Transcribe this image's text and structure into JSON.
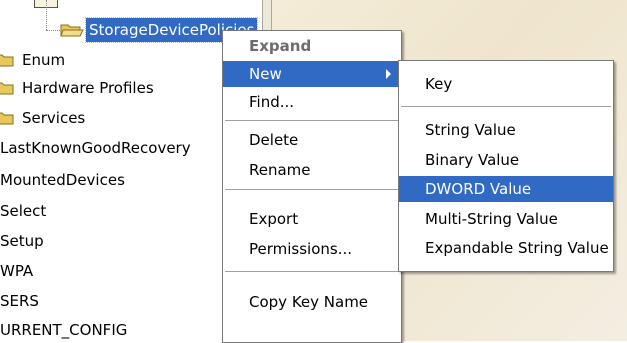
{
  "tree": {
    "selected": "StorageDevicePolicies",
    "items": [
      {
        "label": "Enum",
        "folder": true
      },
      {
        "label": "Hardware Profiles",
        "folder": true
      },
      {
        "label": "Services",
        "folder": true
      },
      {
        "label": "LastKnownGoodRecovery",
        "folder": false
      },
      {
        "label": "MountedDevices",
        "folder": false
      },
      {
        "label": "Select",
        "folder": false
      },
      {
        "label": "Setup",
        "folder": false
      },
      {
        "label": "WPA",
        "folder": false
      },
      {
        "label": "SERS",
        "folder": false
      },
      {
        "label": "URRENT_CONFIG",
        "folder": false
      }
    ]
  },
  "context_menu": {
    "items": [
      {
        "label": "Expand",
        "style": "bold"
      },
      {
        "label": "New",
        "style": "highlighted",
        "submenu": true
      },
      {
        "label": "Find...",
        "style": "normal"
      },
      {
        "label": "Delete",
        "style": "normal"
      },
      {
        "label": "Rename",
        "style": "normal"
      },
      {
        "label": "Export",
        "style": "normal"
      },
      {
        "label": "Permissions...",
        "style": "normal"
      },
      {
        "label": "Copy Key Name",
        "style": "normal"
      }
    ]
  },
  "submenu": {
    "items": [
      {
        "label": "Key"
      },
      {
        "label": "String Value"
      },
      {
        "label": "Binary Value"
      },
      {
        "label": "DWORD Value",
        "highlighted": true
      },
      {
        "label": "Multi-String Value"
      },
      {
        "label": "Expandable String Value"
      }
    ]
  },
  "colors": {
    "highlight": "#316ac5",
    "folder": "#e8c85a",
    "menu_disabled_text": "#6d6d6d"
  },
  "icons": [
    "folder-icon",
    "folder-open-icon",
    "submenu-arrow-icon"
  ]
}
